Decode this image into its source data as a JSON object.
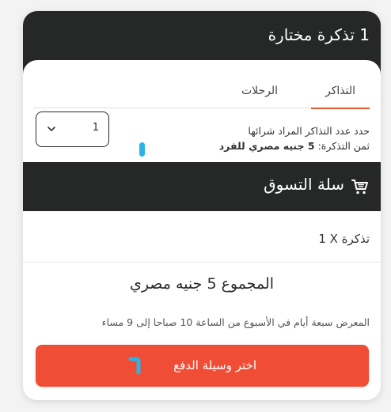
{
  "header": {
    "title": "1 تذكرة مختارة"
  },
  "tabs": [
    {
      "label": "التذاكر",
      "active": true
    },
    {
      "label": "الرحلات",
      "active": false
    }
  ],
  "tickets": {
    "instruction": "حدد عدد التذاكر المراد شرائها",
    "price_prefix": "ثمن التذكرة:",
    "price_value": "5 جنيه مصري للفرد",
    "quantity": "1"
  },
  "cart": {
    "title": "سلة التسوق",
    "item": "1 X تذكرة",
    "total": "المجموع 5 جنيه مصري",
    "hours_note": "المعرض سبعة أيام في الأسبوع من الساعة 10 صباحا إلى 9 مساء"
  },
  "payment": {
    "button_label": "اختر وسيلة الدفع"
  },
  "colors": {
    "dark_bar": "#262828",
    "accent_orange": "#e25a2f",
    "pay_button": "#ef4d35",
    "marker_blue": "#2eb3e6"
  },
  "icons": [
    "chevron-down-icon",
    "cart-icon",
    "pay-indicator-icon"
  ]
}
